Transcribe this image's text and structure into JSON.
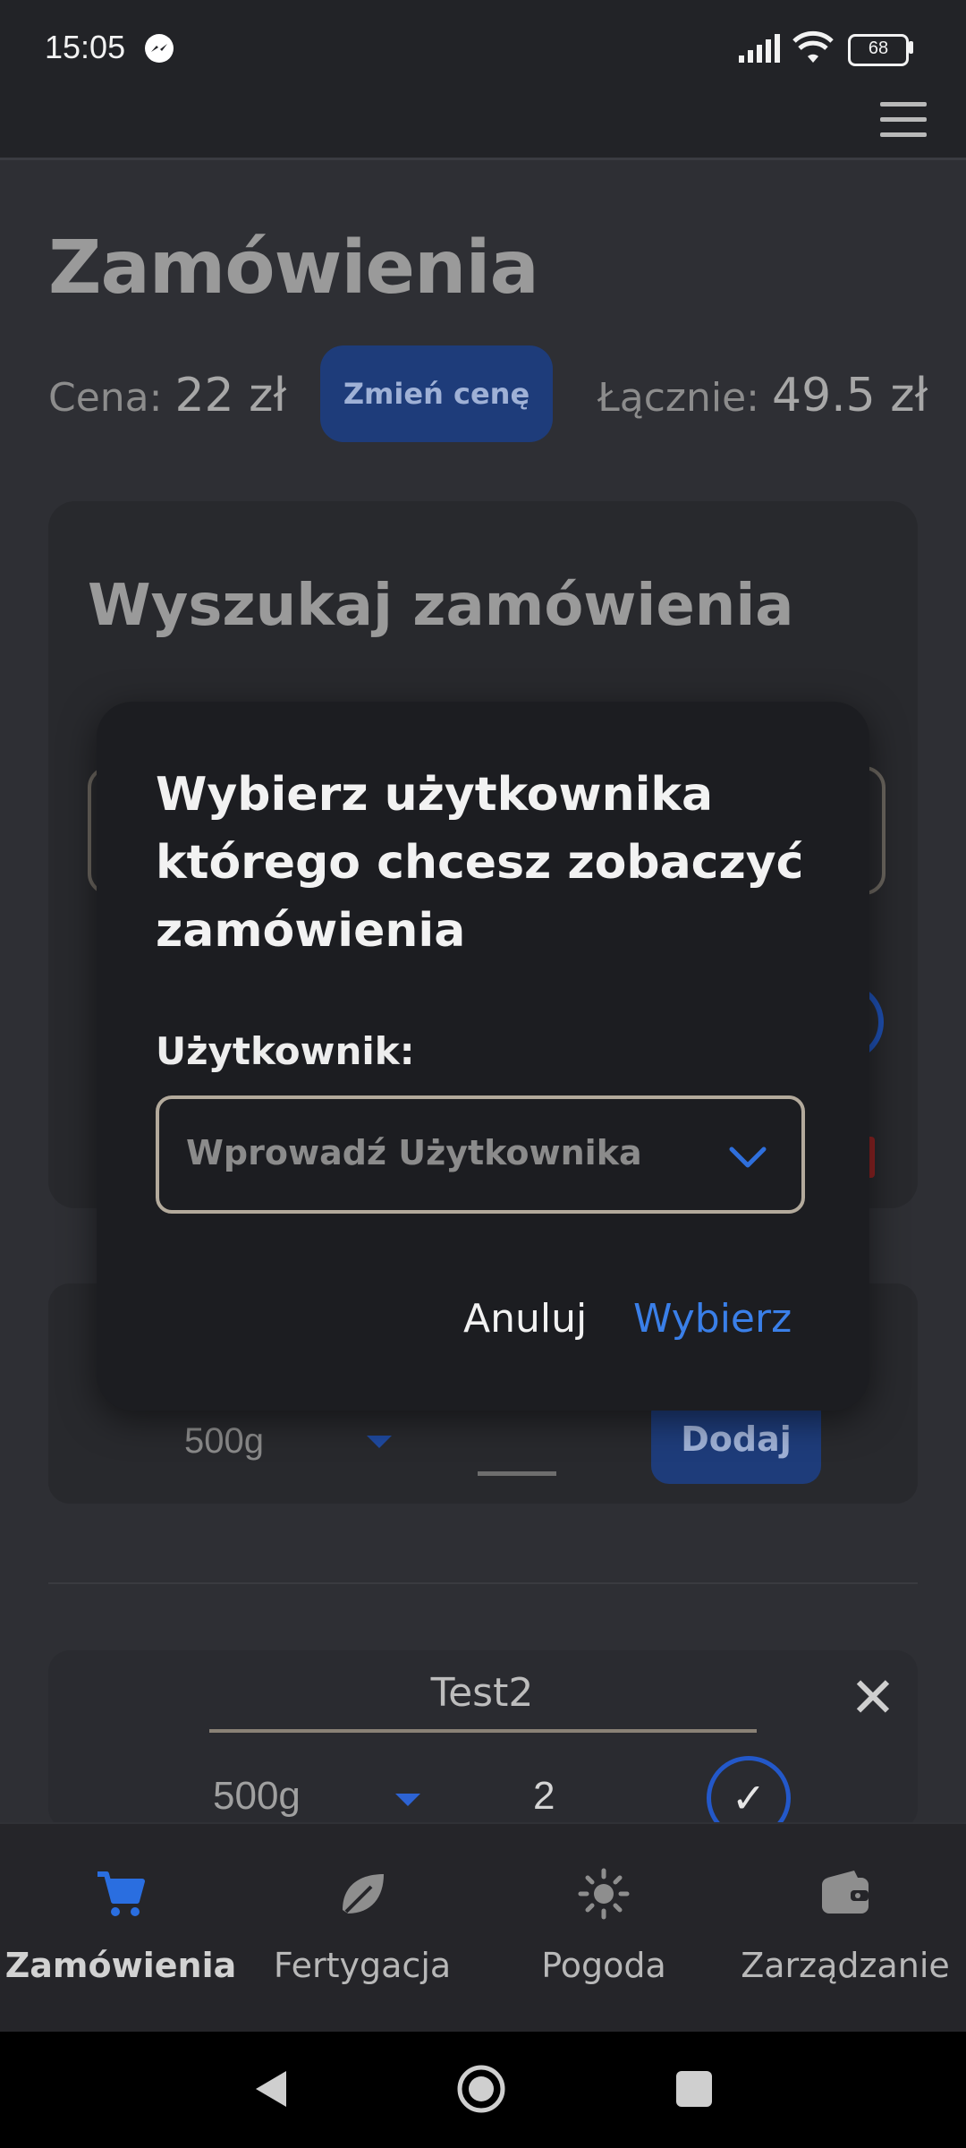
{
  "status_bar": {
    "time": "15:05",
    "battery": "68"
  },
  "page": {
    "title": "Zamówienia",
    "price_label": "Cena:",
    "price_value": "22 zł",
    "change_price_button": "Zmień cenę",
    "total_label": "Łącznie:",
    "total_value": "49.5 zł"
  },
  "search_card": {
    "title": "Wyszukaj zamówienia"
  },
  "order_row_new": {
    "weight": "500g",
    "add_button": "Dodaj"
  },
  "order_row": {
    "name": "Test2",
    "weight": "500g",
    "quantity": "2"
  },
  "dialog": {
    "title": "Wybierz użytkownika którego chcesz zobaczyć zamówienia",
    "field_label": "Użytkownik:",
    "select_placeholder": "Wprowadź Użytkownika",
    "cancel_button": "Anuluj",
    "confirm_button": "Wybierz"
  },
  "bottom_nav": {
    "items": [
      {
        "label": "Zamówienia",
        "icon": "cart-icon",
        "active": true
      },
      {
        "label": "Fertygacja",
        "icon": "leaf-icon",
        "active": false
      },
      {
        "label": "Pogoda",
        "icon": "sun-icon",
        "active": false
      },
      {
        "label": "Zarządzanie",
        "icon": "wallet-icon",
        "active": false
      }
    ]
  },
  "colors": {
    "accent_blue": "#3a7fe8",
    "dialog_bg": "#1c1d21",
    "page_bg": "#2e2f34"
  }
}
